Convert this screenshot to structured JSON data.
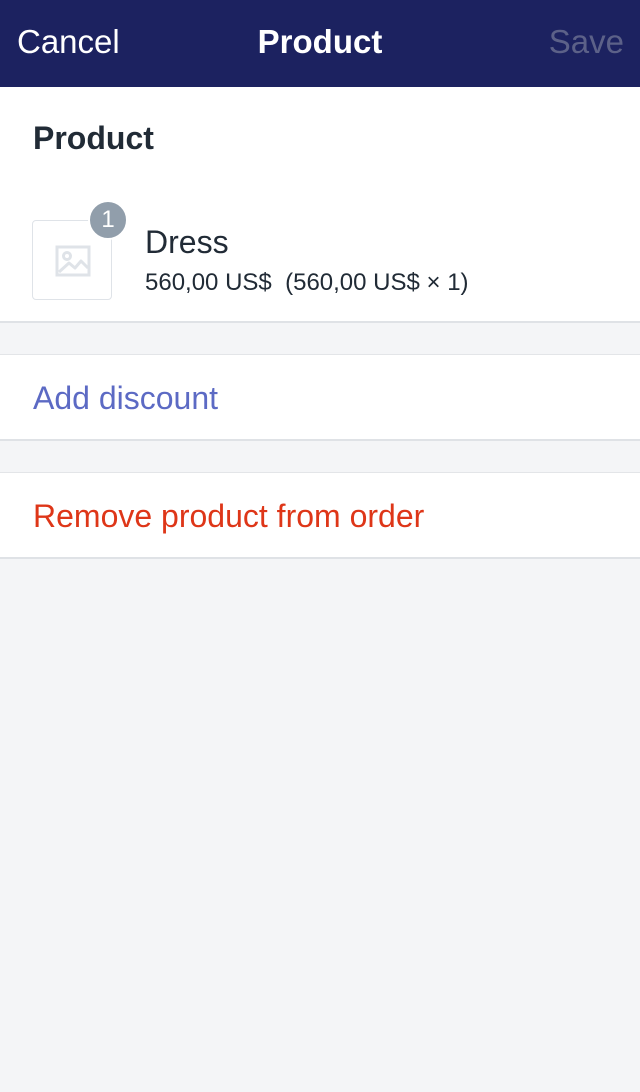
{
  "navbar": {
    "cancel_label": "Cancel",
    "title": "Product",
    "save_label": "Save"
  },
  "product_section": {
    "heading": "Product",
    "item": {
      "name": "Dress",
      "quantity_badge": "1",
      "price_line": "560,00 US$  (560,00 US$ × 1)",
      "thumbnail_icon": "image-placeholder-icon"
    }
  },
  "actions": {
    "add_discount_label": "Add discount",
    "remove_product_label": "Remove product from order"
  },
  "colors": {
    "navbar_bg": "#1c2260",
    "link_primary": "#5c6ac4",
    "destructive": "#de3618",
    "save_disabled": "#5c6188",
    "page_bg": "#f4f5f7"
  }
}
